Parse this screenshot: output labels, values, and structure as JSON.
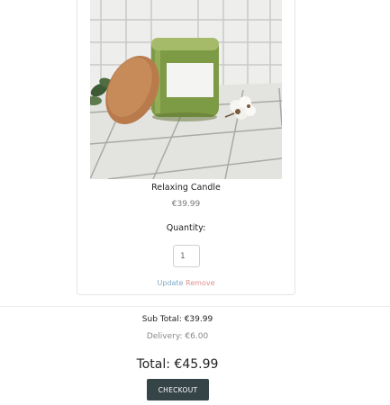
{
  "product": {
    "name": "Relaxing Candle",
    "price": "€39.99",
    "quantity_label": "Quantity:",
    "quantity_value": "1"
  },
  "actions": {
    "update_label": "Update",
    "remove_label": "Remove"
  },
  "summary": {
    "subtotal": "Sub Total: €39.99",
    "delivery": "Delivery: €6.00",
    "total": "Total: €45.99"
  },
  "checkout": {
    "label": "CHECKOUT"
  },
  "colors": {
    "checkout_bg": "#354447",
    "update_link": "#7fa9c9",
    "remove_link": "#e0908c"
  }
}
